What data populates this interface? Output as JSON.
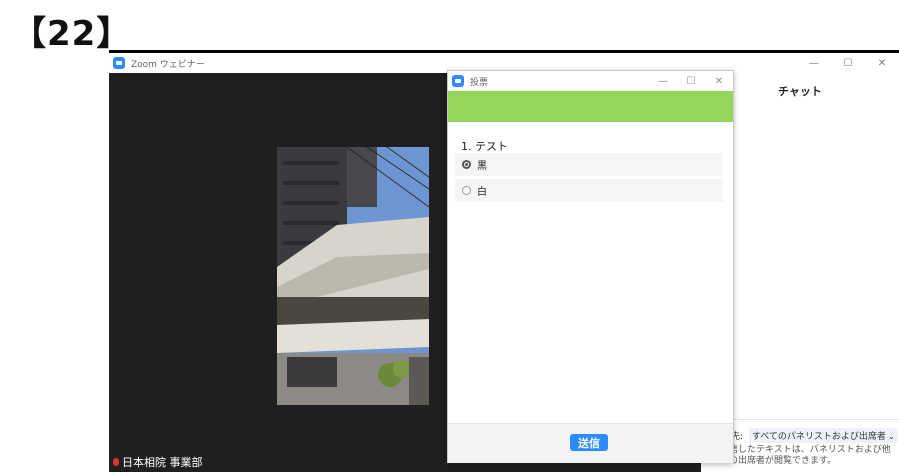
{
  "slide_label": "【22】",
  "zoom_window": {
    "title": "Zoom ウェビナー",
    "controls": {
      "minimize": "—",
      "maximize": "☐",
      "close": "✕"
    },
    "participant_name": "日本相院 事業部"
  },
  "chat": {
    "title": "チャット",
    "send_to_label": "先:",
    "send_to_value": "すべてのパネリストおよび出席者",
    "hint": "信したテキストは、パネリストおよび他の出席者が閲覧できます。"
  },
  "poll": {
    "window_title": "投票",
    "controls": {
      "minimize": "—",
      "maximize": "☐",
      "close": "✕"
    },
    "question": "1. テスト",
    "options": [
      {
        "label": "黒",
        "selected": true
      },
      {
        "label": "白",
        "selected": false
      }
    ],
    "submit_label": "送信",
    "banner_color": "#95d75c",
    "accent_color": "#2d8cff"
  }
}
